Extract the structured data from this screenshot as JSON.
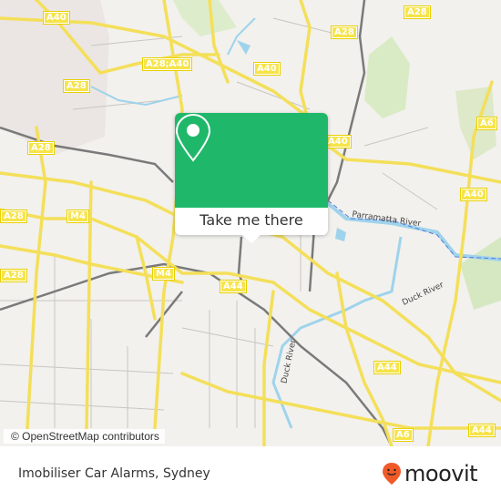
{
  "map": {
    "attribution": "© OpenStreetMap contributors",
    "road_shields": [
      {
        "label": "A40"
      },
      {
        "label": "A28"
      },
      {
        "label": "A28"
      },
      {
        "label": "A28;A40"
      },
      {
        "label": "A40"
      },
      {
        "label": "A28"
      },
      {
        "label": "A28"
      },
      {
        "label": "A40"
      },
      {
        "label": "A6"
      },
      {
        "label": "A40"
      },
      {
        "label": "M4"
      },
      {
        "label": "A28"
      },
      {
        "label": "M4"
      },
      {
        "label": "A28"
      },
      {
        "label": "A44"
      },
      {
        "label": "A44"
      },
      {
        "label": "A44"
      },
      {
        "label": "A6"
      }
    ],
    "river_labels": [
      "Parramatta River",
      "Duck River",
      "Duck River"
    ]
  },
  "popup": {
    "icon": "location-pin-icon",
    "button_label": "Take me there"
  },
  "footer": {
    "title": "Imobiliser Car Alarms, Sydney",
    "logo_text": "moovit",
    "logo_icon": "moovit-smiley-pin-icon"
  },
  "colors": {
    "popup_green": "#1fb86a",
    "road_yellow": "#f6e44a",
    "water_blue": "#9fd3ec",
    "moovit_orange": "#f05a28"
  }
}
